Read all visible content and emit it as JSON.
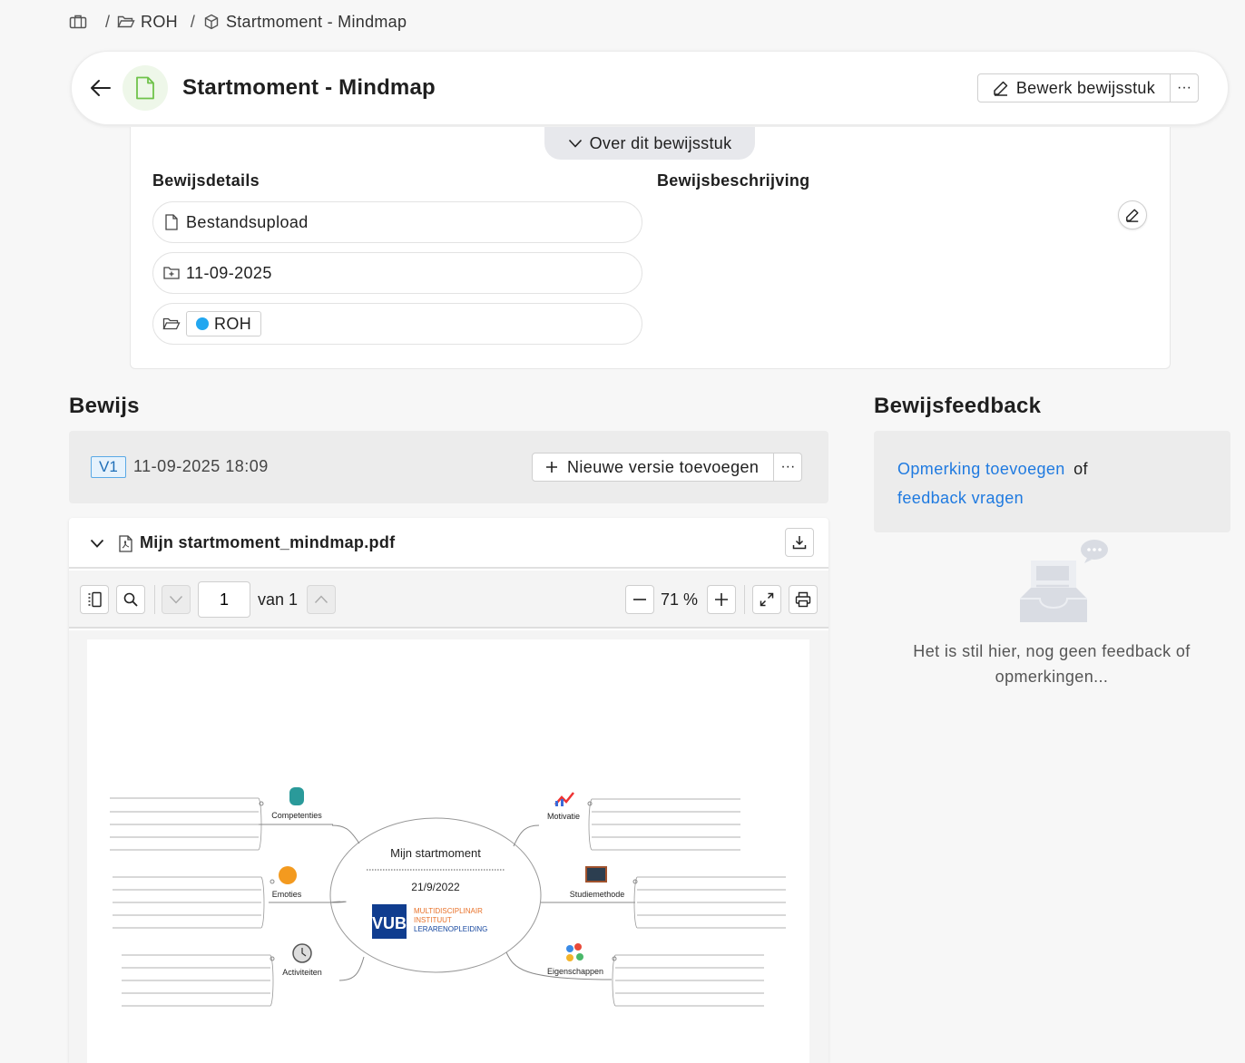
{
  "breadcrumb": {
    "items": [
      "ROH",
      "Startmoment - Mindmap"
    ]
  },
  "header": {
    "title": "Startmoment - Mindmap",
    "edit_label": "Bewerk bewijsstuk",
    "more_label": "···"
  },
  "about": {
    "toggle_label": "Over dit bewijsstuk",
    "details_heading": "Bewijsdetails",
    "description_heading": "Bewijsbeschrijving",
    "type": "Bestandsupload",
    "date": "11-09-2025",
    "folder": "ROH",
    "folder_color": "#22a7f0"
  },
  "evidence": {
    "heading": "Bewijs",
    "version_badge": "V1",
    "version_date": "11-09-2025 18:09",
    "new_version_label": "Nieuwe versie toevoegen",
    "more_label": "···",
    "file_name": "Mijn startmoment_mindmap.pdf",
    "page_current": "1",
    "page_total_text": "van 1",
    "zoom_text": "71 %"
  },
  "mindmap": {
    "center_title": "Mijn startmoment",
    "center_date": "21/9/2022",
    "logo_text": "VUB",
    "logo_lines": [
      "MULTIDISCIPLINAIR",
      "INSTITUUT",
      "LERARENOPLEIDING"
    ],
    "branches": [
      "Competenties",
      "Emoties",
      "Activiteiten",
      "Motivatie",
      "Studiemethode",
      "Eigenschappen"
    ]
  },
  "feedback": {
    "heading": "Bewijsfeedback",
    "add_comment_link": "Opmerking toevoegen",
    "or_text": "of",
    "request_link": "feedback vragen",
    "empty_text": "Het is stil hier, nog geen feedback of opmerkingen..."
  }
}
